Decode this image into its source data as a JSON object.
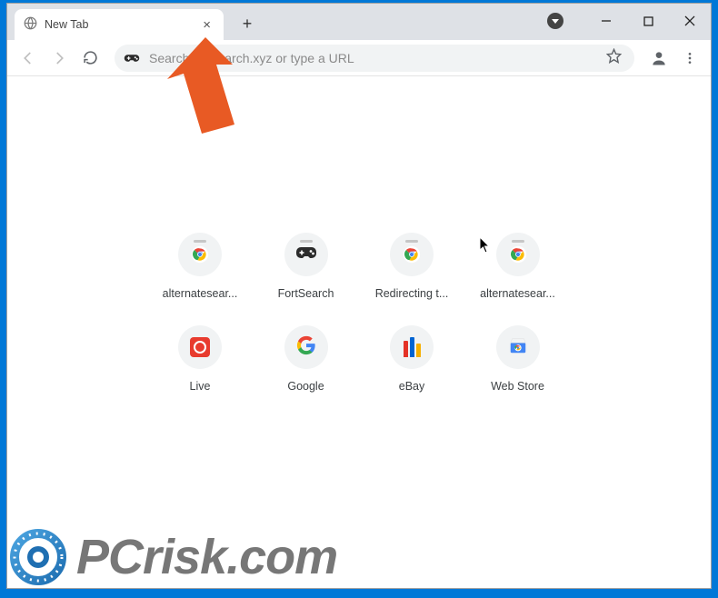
{
  "tab": {
    "title": "New Tab"
  },
  "omnibox": {
    "placeholder": "Search fortsearch.xyz or type a URL"
  },
  "shortcuts": [
    {
      "label": "alternatesear...",
      "icon": "chrome"
    },
    {
      "label": "FortSearch",
      "icon": "gamepad"
    },
    {
      "label": "Redirecting t...",
      "icon": "chrome"
    },
    {
      "label": "alternatesear...",
      "icon": "chrome"
    },
    {
      "label": "Live",
      "icon": "live"
    },
    {
      "label": "Google",
      "icon": "google"
    },
    {
      "label": "eBay",
      "icon": "ebay"
    },
    {
      "label": "Web Store",
      "icon": "webstore"
    }
  ],
  "watermark": {
    "text": "PCrisk.com"
  },
  "colors": {
    "arrow": "#e85a24"
  }
}
